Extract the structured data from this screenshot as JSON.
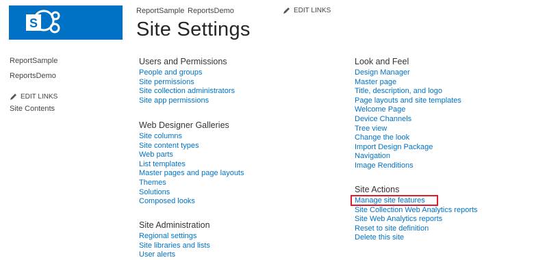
{
  "header": {
    "nav_items": [
      "ReportSample",
      "ReportsDemo"
    ],
    "edit_links": "EDIT LINKS",
    "title": "Site Settings"
  },
  "left_nav": {
    "items": [
      "ReportSample",
      "ReportsDemo"
    ],
    "edit_links": "EDIT LINKS",
    "site_contents": "Site Contents"
  },
  "sections": {
    "users": {
      "title": "Users and Permissions",
      "links": [
        "People and groups",
        "Site permissions",
        "Site collection administrators",
        "Site app permissions"
      ]
    },
    "galleries": {
      "title": "Web Designer Galleries",
      "links": [
        "Site columns",
        "Site content types",
        "Web parts",
        "List templates",
        "Master pages and page layouts",
        "Themes",
        "Solutions",
        "Composed looks"
      ]
    },
    "admin": {
      "title": "Site Administration",
      "links": [
        "Regional settings",
        "Site libraries and lists",
        "User alerts"
      ]
    },
    "look": {
      "title": "Look and Feel",
      "links": [
        "Design Manager",
        "Master page",
        "Title, description, and logo",
        "Page layouts and site templates",
        "Welcome Page",
        "Device Channels",
        "Tree view",
        "Change the look",
        "Import Design Package",
        "Navigation",
        "Image Renditions"
      ]
    },
    "actions": {
      "title": "Site Actions",
      "links": [
        "Manage site features",
        "Site Collection Web Analytics reports",
        "Site Web Analytics reports",
        "Reset to site definition",
        "Delete this site"
      ]
    }
  },
  "colors": {
    "brand": "#0072c6",
    "highlight": "#e21b2b"
  },
  "icons": {
    "logo": "sharepoint-logo-icon",
    "edit": "pencil-icon"
  }
}
